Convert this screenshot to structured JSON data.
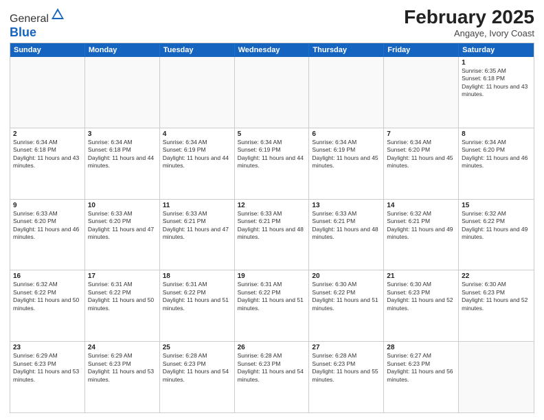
{
  "header": {
    "logo_general": "General",
    "logo_blue": "Blue",
    "month_year": "February 2025",
    "location": "Angaye, Ivory Coast"
  },
  "days_of_week": [
    "Sunday",
    "Monday",
    "Tuesday",
    "Wednesday",
    "Thursday",
    "Friday",
    "Saturday"
  ],
  "weeks": [
    [
      {
        "day": "",
        "empty": true
      },
      {
        "day": "",
        "empty": true
      },
      {
        "day": "",
        "empty": true
      },
      {
        "day": "",
        "empty": true
      },
      {
        "day": "",
        "empty": true
      },
      {
        "day": "",
        "empty": true
      },
      {
        "day": "1",
        "sunrise": "6:35 AM",
        "sunset": "6:18 PM",
        "daylight": "11 hours and 43 minutes."
      }
    ],
    [
      {
        "day": "2",
        "sunrise": "6:34 AM",
        "sunset": "6:18 PM",
        "daylight": "11 hours and 43 minutes."
      },
      {
        "day": "3",
        "sunrise": "6:34 AM",
        "sunset": "6:18 PM",
        "daylight": "11 hours and 44 minutes."
      },
      {
        "day": "4",
        "sunrise": "6:34 AM",
        "sunset": "6:19 PM",
        "daylight": "11 hours and 44 minutes."
      },
      {
        "day": "5",
        "sunrise": "6:34 AM",
        "sunset": "6:19 PM",
        "daylight": "11 hours and 44 minutes."
      },
      {
        "day": "6",
        "sunrise": "6:34 AM",
        "sunset": "6:19 PM",
        "daylight": "11 hours and 45 minutes."
      },
      {
        "day": "7",
        "sunrise": "6:34 AM",
        "sunset": "6:20 PM",
        "daylight": "11 hours and 45 minutes."
      },
      {
        "day": "8",
        "sunrise": "6:34 AM",
        "sunset": "6:20 PM",
        "daylight": "11 hours and 46 minutes."
      }
    ],
    [
      {
        "day": "9",
        "sunrise": "6:33 AM",
        "sunset": "6:20 PM",
        "daylight": "11 hours and 46 minutes."
      },
      {
        "day": "10",
        "sunrise": "6:33 AM",
        "sunset": "6:20 PM",
        "daylight": "11 hours and 47 minutes."
      },
      {
        "day": "11",
        "sunrise": "6:33 AM",
        "sunset": "6:21 PM",
        "daylight": "11 hours and 47 minutes."
      },
      {
        "day": "12",
        "sunrise": "6:33 AM",
        "sunset": "6:21 PM",
        "daylight": "11 hours and 48 minutes."
      },
      {
        "day": "13",
        "sunrise": "6:33 AM",
        "sunset": "6:21 PM",
        "daylight": "11 hours and 48 minutes."
      },
      {
        "day": "14",
        "sunrise": "6:32 AM",
        "sunset": "6:21 PM",
        "daylight": "11 hours and 49 minutes."
      },
      {
        "day": "15",
        "sunrise": "6:32 AM",
        "sunset": "6:22 PM",
        "daylight": "11 hours and 49 minutes."
      }
    ],
    [
      {
        "day": "16",
        "sunrise": "6:32 AM",
        "sunset": "6:22 PM",
        "daylight": "11 hours and 50 minutes."
      },
      {
        "day": "17",
        "sunrise": "6:31 AM",
        "sunset": "6:22 PM",
        "daylight": "11 hours and 50 minutes."
      },
      {
        "day": "18",
        "sunrise": "6:31 AM",
        "sunset": "6:22 PM",
        "daylight": "11 hours and 51 minutes."
      },
      {
        "day": "19",
        "sunrise": "6:31 AM",
        "sunset": "6:22 PM",
        "daylight": "11 hours and 51 minutes."
      },
      {
        "day": "20",
        "sunrise": "6:30 AM",
        "sunset": "6:22 PM",
        "daylight": "11 hours and 51 minutes."
      },
      {
        "day": "21",
        "sunrise": "6:30 AM",
        "sunset": "6:23 PM",
        "daylight": "11 hours and 52 minutes."
      },
      {
        "day": "22",
        "sunrise": "6:30 AM",
        "sunset": "6:23 PM",
        "daylight": "11 hours and 52 minutes."
      }
    ],
    [
      {
        "day": "23",
        "sunrise": "6:29 AM",
        "sunset": "6:23 PM",
        "daylight": "11 hours and 53 minutes."
      },
      {
        "day": "24",
        "sunrise": "6:29 AM",
        "sunset": "6:23 PM",
        "daylight": "11 hours and 53 minutes."
      },
      {
        "day": "25",
        "sunrise": "6:28 AM",
        "sunset": "6:23 PM",
        "daylight": "11 hours and 54 minutes."
      },
      {
        "day": "26",
        "sunrise": "6:28 AM",
        "sunset": "6:23 PM",
        "daylight": "11 hours and 54 minutes."
      },
      {
        "day": "27",
        "sunrise": "6:28 AM",
        "sunset": "6:23 PM",
        "daylight": "11 hours and 55 minutes."
      },
      {
        "day": "28",
        "sunrise": "6:27 AM",
        "sunset": "6:23 PM",
        "daylight": "11 hours and 56 minutes."
      },
      {
        "day": "",
        "empty": true
      }
    ]
  ]
}
